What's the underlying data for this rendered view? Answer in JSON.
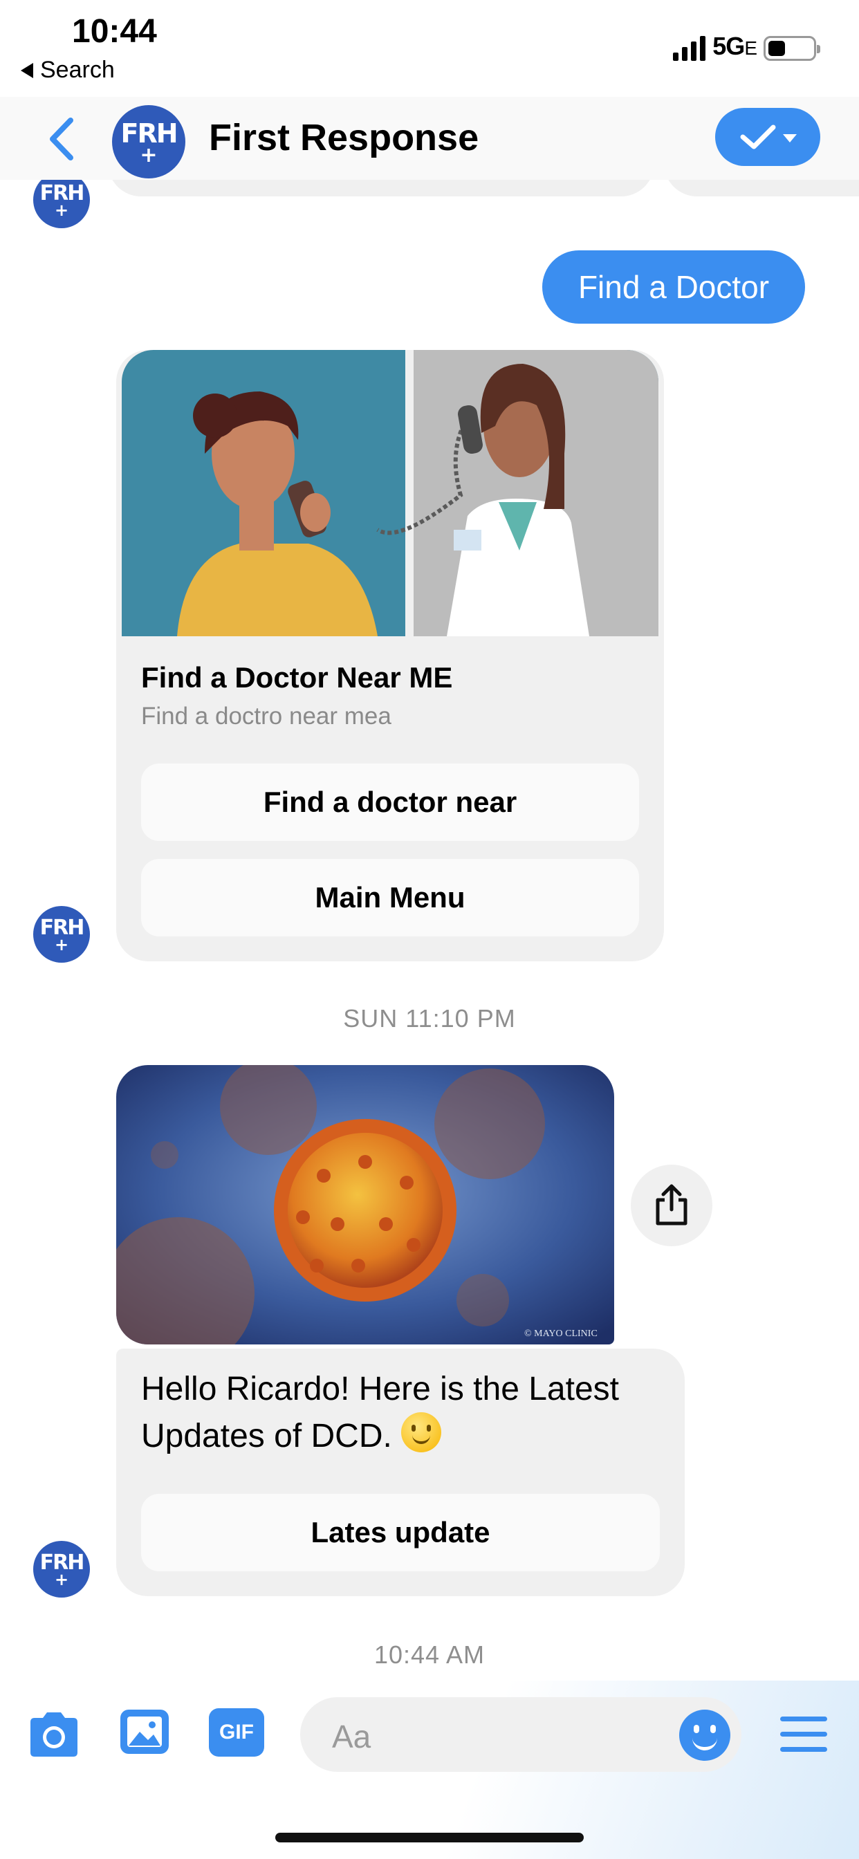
{
  "status_bar": {
    "time": "10:44",
    "back_app": "Search",
    "network": "5G",
    "network_suffix": "E"
  },
  "header": {
    "title": "First Response",
    "avatar_text": "FRH",
    "avatar_mark": "+"
  },
  "messages": {
    "outgoing_text": "Find a Doctor",
    "card": {
      "title": "Find a Doctor Near ME",
      "subtitle": "Find a doctro near mea",
      "buttons": [
        "Find a doctor near",
        "Main Menu"
      ]
    },
    "timestamp_1": "SUN 11:10 PM",
    "news": {
      "image_caption": "© MAYO CLINIC",
      "text": "Hello Ricardo! Here is the Latest Updates of DCD.",
      "button": "Lates update"
    },
    "timestamp_2": "10:44 AM"
  },
  "composer": {
    "placeholder": "Aa",
    "gif_label": "GIF"
  },
  "colors": {
    "accent": "#3b8ef0",
    "avatar": "#2f5ab9",
    "bubble": "#f0f0f0"
  }
}
